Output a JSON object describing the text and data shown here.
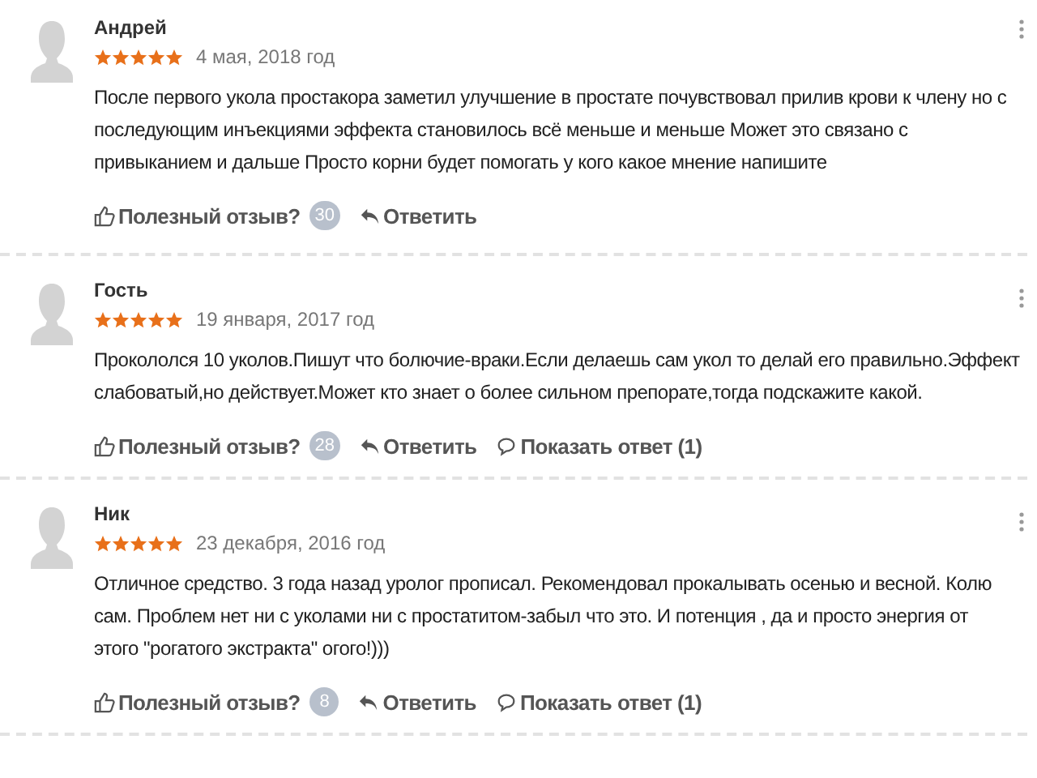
{
  "reviews": [
    {
      "author": "Андрей",
      "stars": 5,
      "date": "4 мая, 2018 год",
      "lines": [
        "После первого укола простакора заметил улучшение в простате почувствовал прилив крови к члену но с",
        "последующим инъекциями эффекта становилось всё меньше и меньше Может это связано с",
        "привыканием и дальше Просто корни будет помогать у кого какое мнение напишите"
      ],
      "helpful": "Полезный отзыв?",
      "helpful_count": "30",
      "reply": "Ответить"
    },
    {
      "author": "Гость",
      "stars": 5,
      "date": "19 января, 2017 год",
      "lines": [
        "Прокололся 10 уколов.Пишут что болючие-враки.Если делаешь сам укол то делай его правильно.Эффект",
        "слабоватый,но действует.Может кто знает о более сильном препорате,тогда подскажите какой."
      ],
      "helpful": "Полезный отзыв?",
      "helpful_count": "28",
      "reply": "Ответить",
      "show_replies": "Показать ответ (1)"
    },
    {
      "author": "Ник",
      "stars": 5,
      "date": "23 декабря, 2016 год",
      "lines": [
        "Отличное средство. 3 года назад уролог прописал. Рекомендовал прокалывать осенью и весной. Колю",
        "сам. Проблем нет ни с уколами ни с простатитом-забыл что это. И потенция , да и просто энергия от",
        "этого \"рогатого экстракта\" огого!)))"
      ],
      "helpful": "Полезный отзыв?",
      "helpful_count": "8",
      "reply": "Ответить",
      "show_replies": "Показать ответ (1)"
    }
  ]
}
